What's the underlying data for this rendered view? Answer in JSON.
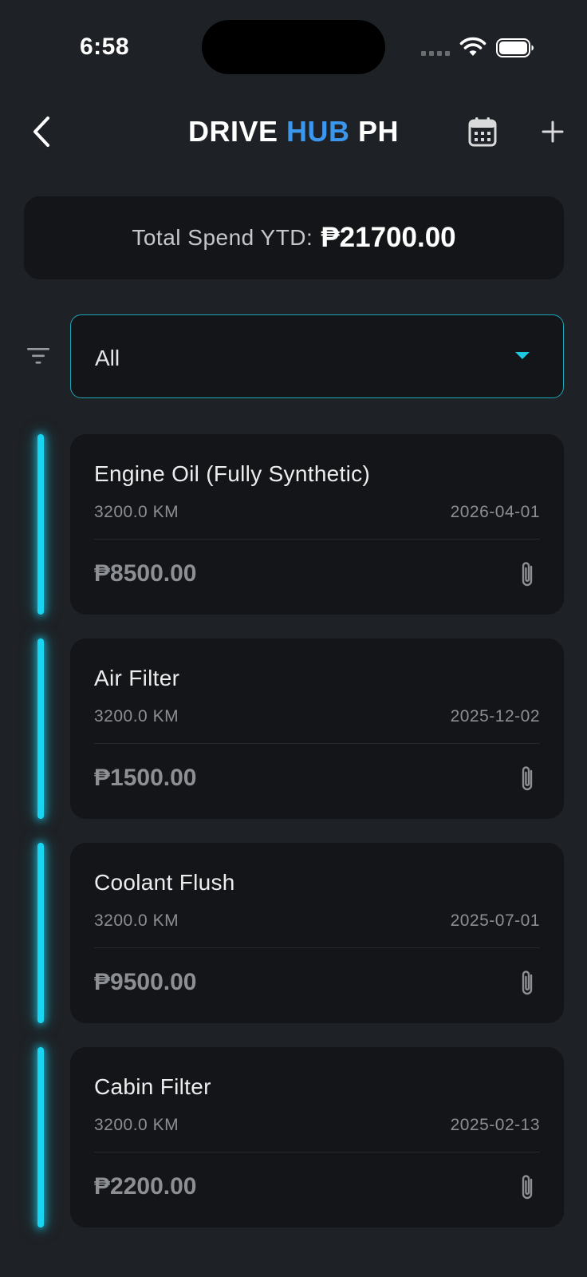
{
  "status_bar": {
    "time": "6:58"
  },
  "header": {
    "title_part1": "DRIVE ",
    "title_part2": "HUB",
    "title_part3": " PH",
    "accent_color": "#3b96ee"
  },
  "summary": {
    "total_label": "Total Spend YTD:",
    "total_value": "₱21700.00"
  },
  "filter": {
    "selected": "All"
  },
  "entries": [
    {
      "title": "Engine Oil (Fully Synthetic)",
      "odometer": "3200.0 KM",
      "date": "2026-04-01",
      "amount": "₱8500.00"
    },
    {
      "title": "Air Filter",
      "odometer": "3200.0 KM",
      "date": "2025-12-02",
      "amount": "₱1500.00"
    },
    {
      "title": "Coolant Flush",
      "odometer": "3200.0 KM",
      "date": "2025-07-01",
      "amount": "₱9500.00"
    },
    {
      "title": "Cabin Filter",
      "odometer": "3200.0 KM",
      "date": "2025-02-13",
      "amount": "₱2200.00"
    }
  ],
  "colors": {
    "background": "#1e2125",
    "card": "#141518",
    "glow": "#18d6f2",
    "border": "#1aa7b8"
  },
  "icons": {
    "back": "chevron-left-icon",
    "calendar": "calendar-icon",
    "add": "plus-icon",
    "filter": "filter-icon",
    "dropdown": "caret-down-icon",
    "attachment": "paperclip-icon"
  }
}
